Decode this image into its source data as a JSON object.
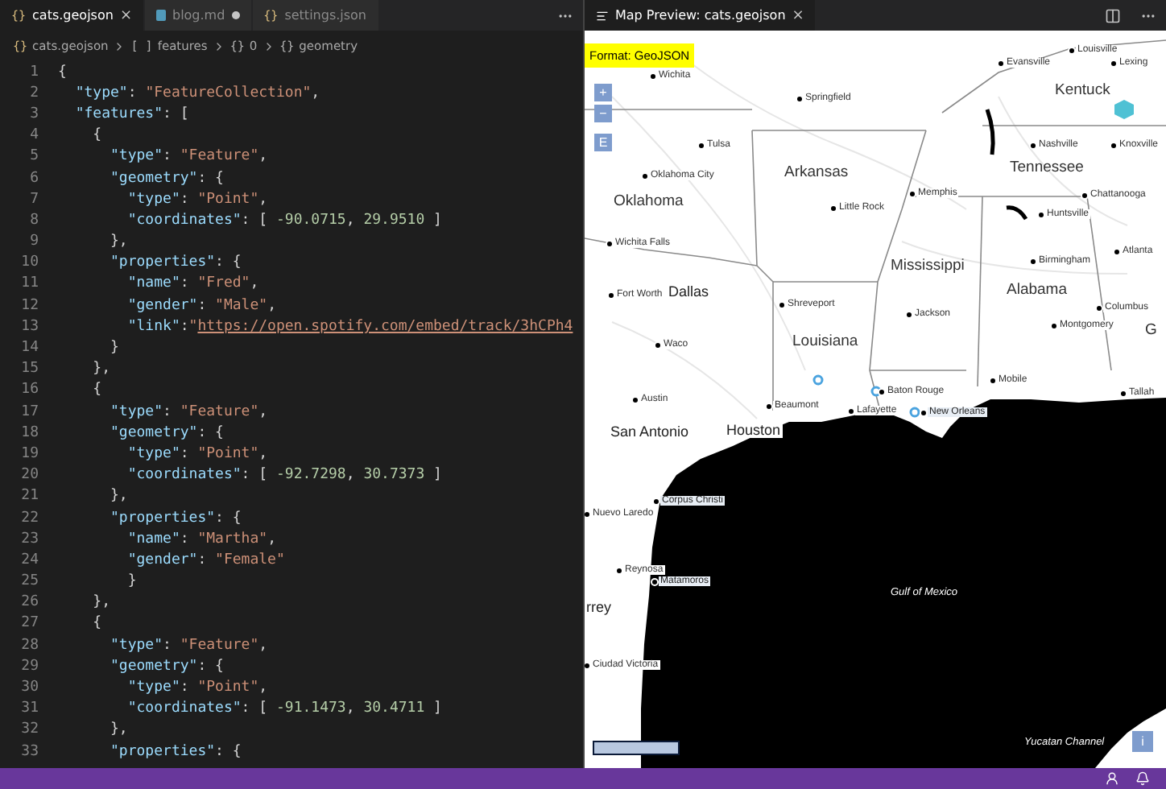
{
  "editor": {
    "tabs": [
      {
        "icon": "{}",
        "label": "cats.geojson",
        "kind": "json",
        "selected": true,
        "modified": false,
        "close": "×"
      },
      {
        "label": "blog.md",
        "kind": "markdown",
        "selected": false,
        "modified": true
      },
      {
        "icon": "{}",
        "label": "settings.json",
        "kind": "json",
        "selected": false,
        "modified": false
      }
    ],
    "breadcrumbs": [
      {
        "icon": "{}",
        "label": "cats.geojson"
      },
      {
        "icon": "[ ]",
        "label": "features"
      },
      {
        "icon": "{}",
        "label": "0"
      },
      {
        "icon": "{}",
        "label": "geometry"
      }
    ],
    "lines": [
      {
        "number": "1",
        "tokens": [
          {
            "kind": "punct",
            "text": "{"
          }
        ]
      },
      {
        "number": "2",
        "tokens": [
          {
            "kind": "key",
            "text": "  \"type\""
          },
          {
            "kind": "punct",
            "text": ": "
          },
          {
            "kind": "str",
            "text": "\"FeatureCollection\""
          },
          {
            "kind": "punct",
            "text": ","
          }
        ]
      },
      {
        "number": "3",
        "tokens": [
          {
            "kind": "key",
            "text": "  \"features\""
          },
          {
            "kind": "punct",
            "text": ": ["
          }
        ]
      },
      {
        "number": "4",
        "tokens": [
          {
            "kind": "punct",
            "text": "    {"
          }
        ]
      },
      {
        "number": "5",
        "tokens": [
          {
            "kind": "key",
            "text": "      \"type\""
          },
          {
            "kind": "punct",
            "text": ": "
          },
          {
            "kind": "str",
            "text": "\"Feature\""
          },
          {
            "kind": "punct",
            "text": ","
          }
        ]
      },
      {
        "number": "6",
        "tokens": [
          {
            "kind": "key",
            "text": "      \"geometry\""
          },
          {
            "kind": "punct",
            "text": ": {"
          }
        ]
      },
      {
        "number": "7",
        "tokens": [
          {
            "kind": "key",
            "text": "        \"type\""
          },
          {
            "kind": "punct",
            "text": ": "
          },
          {
            "kind": "str",
            "text": "\"Point\""
          },
          {
            "kind": "punct",
            "text": ","
          }
        ]
      },
      {
        "number": "8",
        "tokens": [
          {
            "kind": "key",
            "text": "        \"coordinates\""
          },
          {
            "kind": "punct",
            "text": ": [ "
          },
          {
            "kind": "num",
            "text": "-90.0715"
          },
          {
            "kind": "punct",
            "text": ", "
          },
          {
            "kind": "num",
            "text": "29.9510"
          },
          {
            "kind": "punct",
            "text": " ]"
          }
        ]
      },
      {
        "number": "9",
        "tokens": [
          {
            "kind": "punct",
            "text": "      },"
          }
        ]
      },
      {
        "number": "10",
        "tokens": [
          {
            "kind": "key",
            "text": "      \"properties\""
          },
          {
            "kind": "punct",
            "text": ": {"
          }
        ]
      },
      {
        "number": "11",
        "tokens": [
          {
            "kind": "key",
            "text": "        \"name\""
          },
          {
            "kind": "punct",
            "text": ": "
          },
          {
            "kind": "str",
            "text": "\"Fred\""
          },
          {
            "kind": "punct",
            "text": ","
          }
        ]
      },
      {
        "number": "12",
        "tokens": [
          {
            "kind": "key",
            "text": "        \"gender\""
          },
          {
            "kind": "punct",
            "text": ": "
          },
          {
            "kind": "str",
            "text": "\"Male\""
          },
          {
            "kind": "punct",
            "text": ","
          }
        ]
      },
      {
        "number": "13",
        "tokens": [
          {
            "kind": "key",
            "text": "        \"link\""
          },
          {
            "kind": "punct",
            "text": ":"
          },
          {
            "kind": "str",
            "text": "\""
          },
          {
            "kind": "link",
            "text": "https://open.spotify.com/embed/track/3hCPh4"
          }
        ]
      },
      {
        "number": "14",
        "tokens": [
          {
            "kind": "punct",
            "text": "      }"
          }
        ]
      },
      {
        "number": "15",
        "tokens": [
          {
            "kind": "punct",
            "text": "    },"
          }
        ]
      },
      {
        "number": "16",
        "tokens": [
          {
            "kind": "punct",
            "text": "    {"
          }
        ]
      },
      {
        "number": "17",
        "tokens": [
          {
            "kind": "key",
            "text": "      \"type\""
          },
          {
            "kind": "punct",
            "text": ": "
          },
          {
            "kind": "str",
            "text": "\"Feature\""
          },
          {
            "kind": "punct",
            "text": ","
          }
        ]
      },
      {
        "number": "18",
        "tokens": [
          {
            "kind": "key",
            "text": "      \"geometry\""
          },
          {
            "kind": "punct",
            "text": ": {"
          }
        ]
      },
      {
        "number": "19",
        "tokens": [
          {
            "kind": "key",
            "text": "        \"type\""
          },
          {
            "kind": "punct",
            "text": ": "
          },
          {
            "kind": "str",
            "text": "\"Point\""
          },
          {
            "kind": "punct",
            "text": ","
          }
        ]
      },
      {
        "number": "20",
        "tokens": [
          {
            "kind": "key",
            "text": "        \"coordinates\""
          },
          {
            "kind": "punct",
            "text": ": [ "
          },
          {
            "kind": "num",
            "text": "-92.7298"
          },
          {
            "kind": "punct",
            "text": ", "
          },
          {
            "kind": "num",
            "text": "30.7373"
          },
          {
            "kind": "punct",
            "text": " ]"
          }
        ]
      },
      {
        "number": "21",
        "tokens": [
          {
            "kind": "punct",
            "text": "      },"
          }
        ]
      },
      {
        "number": "22",
        "tokens": [
          {
            "kind": "key",
            "text": "      \"properties\""
          },
          {
            "kind": "punct",
            "text": ": {"
          }
        ]
      },
      {
        "number": "23",
        "tokens": [
          {
            "kind": "key",
            "text": "        \"name\""
          },
          {
            "kind": "punct",
            "text": ": "
          },
          {
            "kind": "str",
            "text": "\"Martha\""
          },
          {
            "kind": "punct",
            "text": ","
          }
        ]
      },
      {
        "number": "24",
        "tokens": [
          {
            "kind": "key",
            "text": "        \"gender\""
          },
          {
            "kind": "punct",
            "text": ": "
          },
          {
            "kind": "str",
            "text": "\"Female\""
          }
        ]
      },
      {
        "number": "25",
        "tokens": [
          {
            "kind": "punct",
            "text": "        }"
          }
        ]
      },
      {
        "number": "26",
        "tokens": [
          {
            "kind": "punct",
            "text": "    },"
          }
        ]
      },
      {
        "number": "27",
        "tokens": [
          {
            "kind": "punct",
            "text": "    {"
          }
        ]
      },
      {
        "number": "28",
        "tokens": [
          {
            "kind": "key",
            "text": "      \"type\""
          },
          {
            "kind": "punct",
            "text": ": "
          },
          {
            "kind": "str",
            "text": "\"Feature\""
          },
          {
            "kind": "punct",
            "text": ","
          }
        ]
      },
      {
        "number": "29",
        "tokens": [
          {
            "kind": "key",
            "text": "      \"geometry\""
          },
          {
            "kind": "punct",
            "text": ": {"
          }
        ]
      },
      {
        "number": "30",
        "tokens": [
          {
            "kind": "key",
            "text": "        \"type\""
          },
          {
            "kind": "punct",
            "text": ": "
          },
          {
            "kind": "str",
            "text": "\"Point\""
          },
          {
            "kind": "punct",
            "text": ","
          }
        ]
      },
      {
        "number": "31",
        "tokens": [
          {
            "kind": "key",
            "text": "        \"coordinates\""
          },
          {
            "kind": "punct",
            "text": ": [ "
          },
          {
            "kind": "num",
            "text": "-91.1473"
          },
          {
            "kind": "punct",
            "text": ", "
          },
          {
            "kind": "num",
            "text": "30.4711"
          },
          {
            "kind": "punct",
            "text": " ]"
          }
        ]
      },
      {
        "number": "32",
        "tokens": [
          {
            "kind": "punct",
            "text": "      },"
          }
        ]
      },
      {
        "number": "33",
        "tokens": [
          {
            "kind": "key",
            "text": "      \"properties\""
          },
          {
            "kind": "punct",
            "text": ": {"
          }
        ]
      }
    ]
  },
  "preview": {
    "tab": {
      "label": "Map Preview: cats.geojson",
      "close": "×",
      "selected": true
    },
    "format": "Format: GeoJSON",
    "zoom_controls": [
      "+",
      "−",
      "E"
    ],
    "info_button": "i",
    "labels": [
      {
        "text": "Wichita",
        "kind": "city"
      },
      {
        "text": "Springfield",
        "kind": "city"
      },
      {
        "text": "Evansville",
        "kind": "city"
      },
      {
        "text": "Louisville",
        "kind": "city"
      },
      {
        "text": "Lexing",
        "kind": "city"
      },
      {
        "text": "Kentuck",
        "kind": "state"
      },
      {
        "text": "Tulsa",
        "kind": "city"
      },
      {
        "text": "Nashville",
        "kind": "city"
      },
      {
        "text": "Knoxville",
        "kind": "city"
      },
      {
        "text": "Oklahoma City",
        "kind": "city"
      },
      {
        "text": "Arkansas",
        "kind": "state"
      },
      {
        "text": "Tennessee",
        "kind": "state"
      },
      {
        "text": "Oklahoma",
        "kind": "state"
      },
      {
        "text": "Memphis",
        "kind": "city"
      },
      {
        "text": "Little Rock",
        "kind": "city"
      },
      {
        "text": "Chattanooga",
        "kind": "city"
      },
      {
        "text": "Huntsville",
        "kind": "city"
      },
      {
        "text": "Wichita Falls",
        "kind": "city"
      },
      {
        "text": "Birmingham",
        "kind": "city"
      },
      {
        "text": "Atlanta",
        "kind": "city"
      },
      {
        "text": "Mississippi",
        "kind": "state"
      },
      {
        "text": "Fort Worth",
        "kind": "city"
      },
      {
        "text": "Dallas",
        "kind": "bigcity"
      },
      {
        "text": "Alabama",
        "kind": "state"
      },
      {
        "text": "Shreveport",
        "kind": "city"
      },
      {
        "text": "Jackson",
        "kind": "city"
      },
      {
        "text": "Columbus",
        "kind": "city"
      },
      {
        "text": "Montgomery",
        "kind": "city"
      },
      {
        "text": "G",
        "kind": "state"
      },
      {
        "text": "Louisiana",
        "kind": "state"
      },
      {
        "text": "Waco",
        "kind": "city"
      },
      {
        "text": "Mobile",
        "kind": "city"
      },
      {
        "text": "Austin",
        "kind": "city"
      },
      {
        "text": "Baton Rouge",
        "kind": "city"
      },
      {
        "text": "Tallah",
        "kind": "city"
      },
      {
        "text": "Beaumont",
        "kind": "city"
      },
      {
        "text": "Lafayette",
        "kind": "city"
      },
      {
        "text": "New Orleans",
        "kind": "coastal"
      },
      {
        "text": "San Antonio",
        "kind": "bigcity"
      },
      {
        "text": "Houston",
        "kind": "bigcity"
      },
      {
        "text": "Corpus Christi",
        "kind": "coastal"
      },
      {
        "text": "Nuevo Laredo",
        "kind": "city"
      },
      {
        "text": "Reynosa",
        "kind": "city"
      },
      {
        "text": "Matamoros",
        "kind": "coastal"
      },
      {
        "text": "rrey",
        "kind": "bigcity"
      },
      {
        "text": "Gulf of Mexico",
        "kind": "water"
      },
      {
        "text": "Ciudad Victoria",
        "kind": "city"
      },
      {
        "text": "Yucatan Channel",
        "kind": "water"
      }
    ]
  }
}
